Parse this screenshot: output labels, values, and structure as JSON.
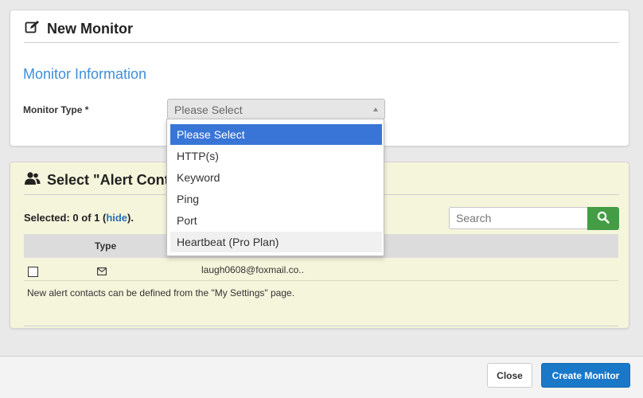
{
  "monitor": {
    "title": "New Monitor",
    "section_title": "Monitor Information",
    "type_label": "Monitor Type *",
    "select_value": "Please Select",
    "options": [
      "Please Select",
      "HTTP(s)",
      "Keyword",
      "Ping",
      "Port",
      "Heartbeat (Pro Plan)"
    ]
  },
  "alerts": {
    "title": "Select \"Alert Conta",
    "selected_prefix": "Selected: 0 of 1 (",
    "selected_link": "hide",
    "selected_suffix": ").",
    "search_placeholder": "Search",
    "col_type": "Type",
    "rows": [
      {
        "email": "laugh0608@foxmail.co.."
      }
    ],
    "note": "New alert contacts can be defined from the \"My Settings\" page."
  },
  "footer": {
    "close_label": "Close",
    "create_label": "Create Monitor"
  },
  "colors": {
    "accent": "#3d8fd8",
    "primary": "#1a78c9",
    "search_green": "#449d44",
    "panel_bg": "#f5f5dc"
  }
}
